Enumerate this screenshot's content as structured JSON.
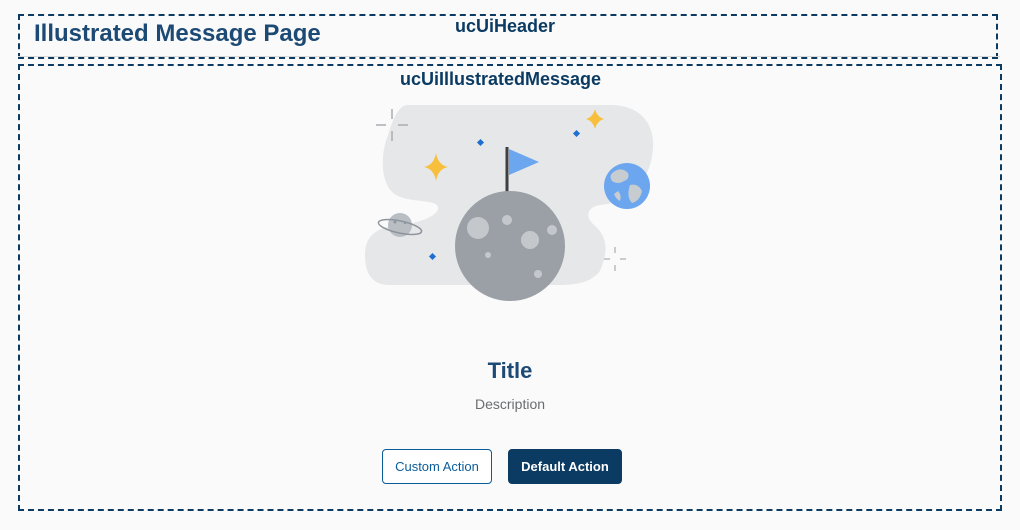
{
  "header": {
    "component_label": "ucUiHeader",
    "title": "Illustrated Message Page"
  },
  "illustrated_message": {
    "component_label": "ucUiIllustratedMessage",
    "title": "Title",
    "description": "Description",
    "illustration": {
      "icons": [
        "moon-icon",
        "flag-icon",
        "globe-icon",
        "planet-icon",
        "sparkle-icon"
      ]
    },
    "actions": {
      "custom_label": "Custom Action",
      "default_label": "Default Action"
    }
  },
  "colors": {
    "primary": "#0b3b63",
    "title": "#1d4a74",
    "accent_blue": "#0b5d9a",
    "moon_gray": "#9aa0a6",
    "star_yellow": "#f7bf3c",
    "cloud_gray": "#e6e7e9"
  }
}
